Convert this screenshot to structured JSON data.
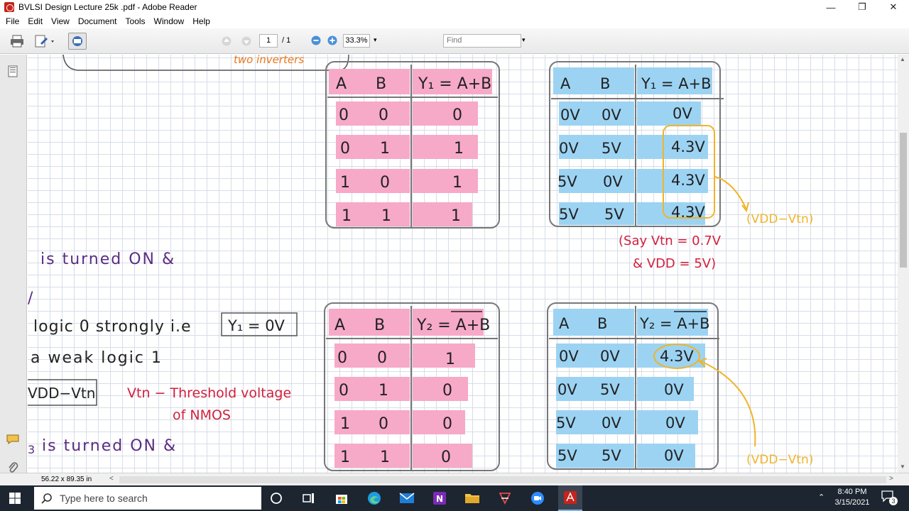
{
  "window": {
    "title": "BVLSI Design Lecture 25k .pdf - Adobe Reader",
    "minimize": "—",
    "maximize": "❐",
    "close": "✕"
  },
  "menu": [
    "File",
    "Edit",
    "View",
    "Document",
    "Tools",
    "Window",
    "Help"
  ],
  "toolbar": {
    "page_current": "1",
    "page_total": "/ 1",
    "zoom": "33.3%",
    "find_placeholder": "Find"
  },
  "status": {
    "page_size": "56.22 x 89.35 in",
    "nav_left": "<",
    "nav_right": ">"
  },
  "notes": {
    "top_bubble": "two inverters",
    "line1": "is turned ON &",
    "line2": "logic 0 strongly i.e",
    "line2_box": "Y₁ = 0V",
    "line3": "a weak logic 1",
    "line4_box": "VDD−Vtn",
    "vtn_label_1": "Vtn − Threshold voltage",
    "vtn_label_2": "of NMOS",
    "line5": "is turned ON &",
    "line5_prefix": "3",
    "say_line1": "(Say Vtn = 0.7V",
    "say_line2": "& VDD = 5V)",
    "callout_top": "(VDD−Vtn)",
    "callout_bottom": "(VDD−Vtn)"
  },
  "tables": {
    "t1": {
      "headers": [
        "A",
        "B",
        "Y₁ = A+B"
      ],
      "rows": [
        [
          "0",
          "0",
          "0"
        ],
        [
          "0",
          "1",
          "1"
        ],
        [
          "1",
          "0",
          "1"
        ],
        [
          "1",
          "1",
          "1"
        ]
      ]
    },
    "t2": {
      "headers": [
        "A",
        "B",
        "Y₁ = A+B"
      ],
      "rows": [
        [
          "0V",
          "0V",
          "0V"
        ],
        [
          "0V",
          "5V",
          "4.3V"
        ],
        [
          "5V",
          "0V",
          "4.3V"
        ],
        [
          "5V",
          "5V",
          "4.3V"
        ]
      ]
    },
    "t3": {
      "headers": [
        "A",
        "B",
        "Y₂ = A+B"
      ],
      "rows": [
        [
          "0",
          "0",
          "1"
        ],
        [
          "0",
          "1",
          "0"
        ],
        [
          "1",
          "0",
          "0"
        ],
        [
          "1",
          "1",
          "0"
        ]
      ]
    },
    "t4": {
      "headers": [
        "A",
        "B",
        "Y₂ = A+B"
      ],
      "rows": [
        [
          "0V",
          "0V",
          "4.3V"
        ],
        [
          "0V",
          "5V",
          "0V"
        ],
        [
          "5V",
          "0V",
          "0V"
        ],
        [
          "5V",
          "5V",
          "0V"
        ]
      ]
    }
  },
  "taskbar": {
    "search_placeholder": "Type here to search",
    "time": "8:40 PM",
    "date": "3/15/2021",
    "notification_count": "3"
  },
  "colors": {
    "pink": "#f7a9c8",
    "blue": "#9cd3f3",
    "ink": "#222222",
    "purple": "#5a2d82",
    "red": "#d21f3c",
    "orange": "#e8771d",
    "yellow": "#f0b429"
  }
}
